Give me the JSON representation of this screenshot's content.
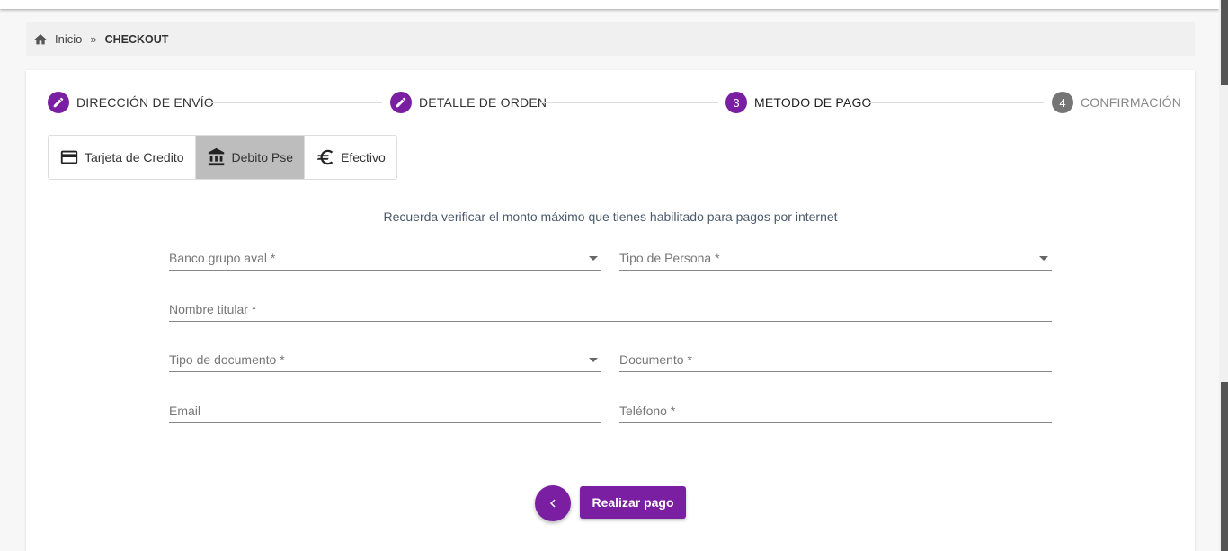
{
  "breadcrumb": {
    "home": "Inicio",
    "separator": "»",
    "current": "CHECKOUT"
  },
  "stepper": {
    "steps": [
      {
        "label": "DIRECCIÓN DE ENVÍO",
        "icon": "edit-icon",
        "state": "done"
      },
      {
        "label": "DETALLE DE ORDEN",
        "icon": "edit-icon",
        "state": "done"
      },
      {
        "label": "METODO DE PAGO",
        "number": "3",
        "state": "active"
      },
      {
        "label": "CONFIRMACIÓN",
        "number": "4",
        "state": "pending"
      }
    ]
  },
  "payment_tabs": [
    {
      "label": "Tarjeta de Credito",
      "icon": "credit-card-icon"
    },
    {
      "label": "Debito Pse",
      "icon": "bank-icon",
      "active": true
    },
    {
      "label": "Efectivo",
      "icon": "euro-icon"
    }
  ],
  "notice": "Recuerda verificar el monto máximo que tienes habilitado para pagos por internet",
  "form": {
    "bank": "Banco grupo aval *",
    "person_type": "Tipo de Persona *",
    "holder_name": "Nombre titular *",
    "document_type": "Tipo de documento *",
    "document": "Documento *",
    "email": "Email",
    "phone": "Teléfono *"
  },
  "actions": {
    "back": "back-chevron-icon",
    "submit": "Realizar pago"
  },
  "colors": {
    "accent": "#7b1fa2",
    "step_pending": "#757575",
    "active_tab": "#bdbdbd"
  }
}
